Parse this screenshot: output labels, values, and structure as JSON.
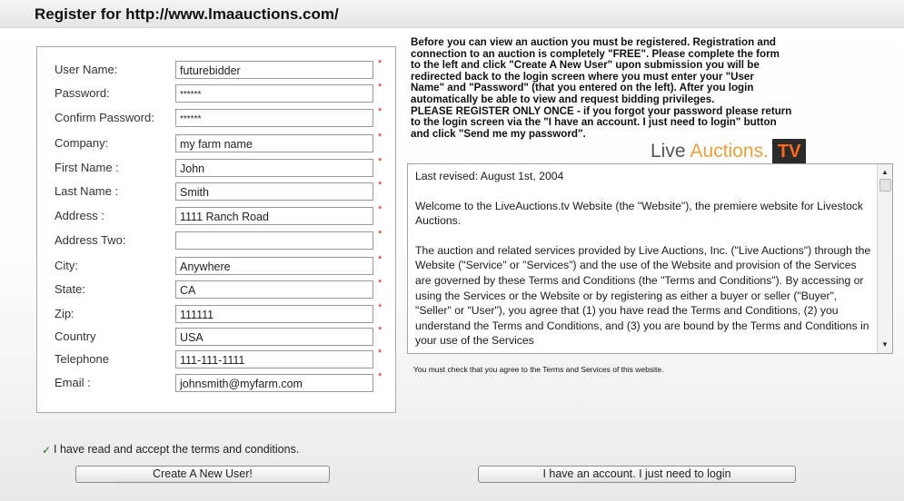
{
  "header": {
    "title": "Register for http://www.lmaauctions.com/"
  },
  "form": {
    "fields": [
      {
        "label": "User Name:",
        "value": "futurebidder",
        "type": "text"
      },
      {
        "label": "Password:",
        "value": "******",
        "type": "password"
      },
      {
        "label": "Confirm Password:",
        "value": "******",
        "type": "password"
      },
      {
        "label": "Company:",
        "value": "my farm name",
        "type": "text"
      },
      {
        "label": "First Name :",
        "value": "John",
        "type": "text"
      },
      {
        "label": "Last Name :",
        "value": "Smith",
        "type": "text"
      },
      {
        "label": "Address :",
        "value": "1111 Ranch Road",
        "type": "text"
      },
      {
        "label": "Address Two:",
        "value": "",
        "type": "text"
      },
      {
        "label": "City:",
        "value": "Anywhere",
        "type": "text"
      },
      {
        "label": "State:",
        "value": "CA",
        "type": "text"
      },
      {
        "label": "Zip:",
        "value": "111111",
        "type": "text"
      },
      {
        "label": "Country",
        "value": "USA",
        "type": "text"
      },
      {
        "label": "Telephone",
        "value": "111-111-1111",
        "type": "text"
      },
      {
        "label": "Email :",
        "value": "johnsmith@myfarm.com",
        "type": "text"
      }
    ],
    "required_marker": "*"
  },
  "info": {
    "text": "Before you can view an auction you must be registered. Registration and\nconnection to an auction is completely \"FREE\". Please complete the form\nto the left and click \"Create A New User\" upon submission you will be\nredirected back to the login screen where you must enter your \"User\nName\" and \"Password\" (that you entered on the left). After you login\nautomatically be able to view and request bidding privileges.\nPLEASE REGISTER ONLY ONCE - if you forgot your password please return\nto the login screen via the \"I have an account. I just need to login\" button\nand click \"Send me my password\"."
  },
  "logo": {
    "live": "Live",
    "auctions": "Auctions",
    "dot": ".",
    "tv": "TV"
  },
  "terms": {
    "paragraphs": [
      "Last revised: August 1st, 2004",
      "Welcome to the LiveAuctions.tv Website (the \"Website\"), the premiere website for Livestock Auctions.",
      "The auction and related services provided by Live Auctions, Inc. (\"Live Auctions\") through the Website (\"Service\" or \"Services\") and the use of the Website and provision of the Services are governed by these Terms and Conditions (the \"Terms and Conditions\"). By accessing or using the Services or the Website or by registering as either a buyer or seller (\"Buyer\", \"Seller\" or \"User\"), you agree that (1) you have read the Terms and Conditions, (2) you understand the Terms and Conditions, and (3) you are bound by the Terms and Conditions in your use of the Services"
    ],
    "note": "You must check that you agree to the Terms and Services of this website."
  },
  "accept": {
    "label": "I have read and accept the terms and conditions.",
    "checked": true,
    "mark": "✓"
  },
  "buttons": {
    "create": "Create A New User!",
    "login": "I have an account.  I just need to login"
  }
}
